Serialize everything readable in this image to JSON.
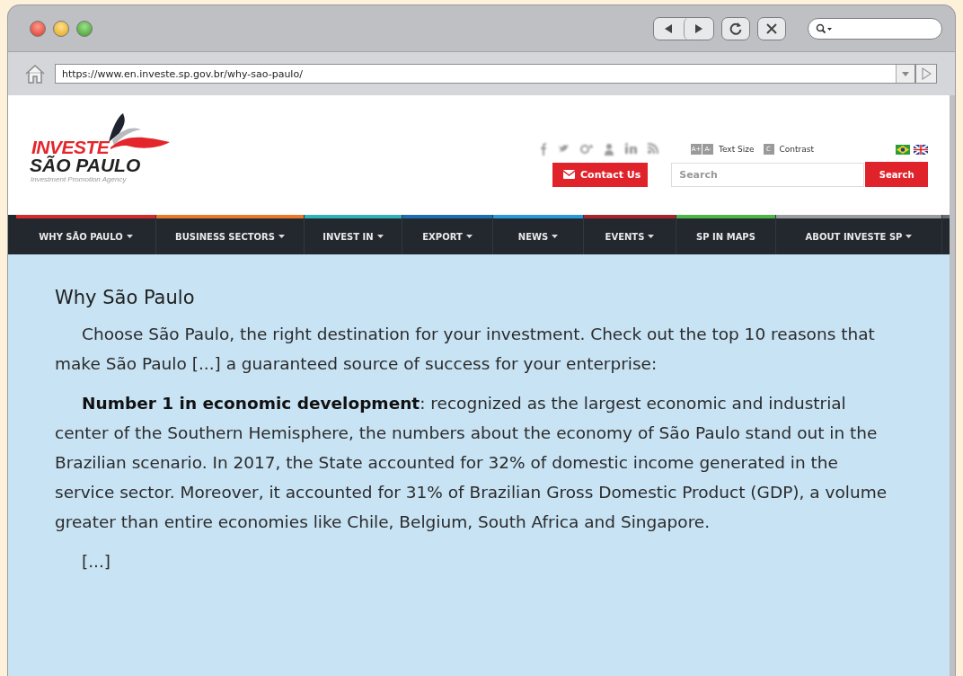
{
  "browser": {
    "url": "https://www.en.investe.sp.gov.br/why-sao-paulo/"
  },
  "header": {
    "logo": {
      "name": "INVESTE",
      "region": "SÃO PAULO",
      "tagline": "Investment Promotion Agency"
    },
    "accessibility": [
      {
        "label": "A+",
        "kind": "key"
      },
      {
        "label": "A-",
        "kind": "key"
      },
      {
        "label": "Text Size",
        "kind": "caption"
      },
      {
        "label": "C",
        "kind": "key"
      },
      {
        "label": "Contrast",
        "kind": "caption"
      }
    ],
    "contact_button": "Contact Us",
    "search": {
      "placeholder": "Search",
      "button": "Search"
    }
  },
  "nav": [
    {
      "label": "WHY SÃO PAULO",
      "has_menu": true,
      "color": "#d52b2b"
    },
    {
      "label": "BUSINESS SECTORS",
      "has_menu": true,
      "color": "#e67a2a"
    },
    {
      "label": "INVEST IN",
      "has_menu": true,
      "color": "#2fb3b8"
    },
    {
      "label": "EXPORT",
      "has_menu": true,
      "color": "#1f6fb0"
    },
    {
      "label": "NEWS",
      "has_menu": true,
      "color": "#2a9ad6"
    },
    {
      "label": "EVENTS",
      "has_menu": true,
      "color": "#a8262b"
    },
    {
      "label": "SP IN MAPS",
      "has_menu": false,
      "color": "#4cb748"
    },
    {
      "label": "ABOUT INVESTE SP",
      "has_menu": true,
      "color": "#9a9da2"
    }
  ],
  "article": {
    "title": "Why São Paulo",
    "paragraphs": [
      "Choose São Paulo, the right destination for your investment. Check out the top 10 reasons that make São Paulo [...] a guaranteed source of success for your enterprise:",
      "**Number 1 in economic development**: recognized as the largest economic and industrial center of the Southern Hemisphere, the numbers about the economy of São Paulo stand out in the Brazilian scenario. In 2017, the State accounted for 32% of domestic income generated in the service sector. Moreover, it accounted for 31% of Brazilian Gross Domestic Product (GDP), a volume greater than entire economies like Chile, Belgium, South Africa and Singapore.",
      "[...]"
    ]
  }
}
